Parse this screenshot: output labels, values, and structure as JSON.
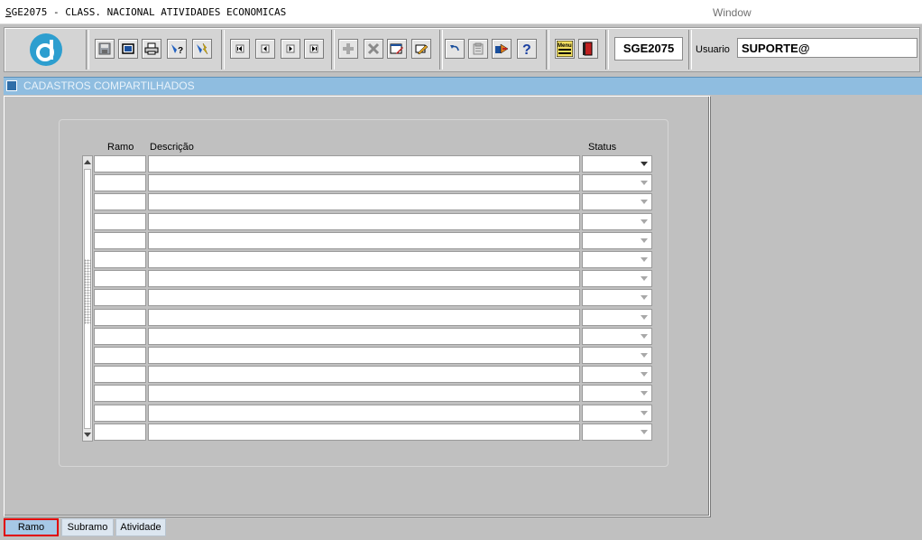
{
  "menubar": {
    "title_accel": "S",
    "title_rest": "GE2075 - CLASS. NACIONAL ATIVIDADES ECONOMICAS",
    "window_menu": "Window"
  },
  "toolbar": {
    "module_code": "SGE2075",
    "user_label": "Usuario",
    "user_value": "SUPORTE@",
    "menu_button_label": "Menu",
    "buttons": [
      {
        "name": "save-icon"
      },
      {
        "name": "window-icon"
      },
      {
        "name": "print-icon"
      },
      {
        "name": "query-icon"
      },
      {
        "name": "execute-query-icon"
      },
      {
        "name": "first-record-icon"
      },
      {
        "name": "previous-record-icon"
      },
      {
        "name": "next-record-icon"
      },
      {
        "name": "last-record-icon"
      },
      {
        "name": "insert-record-icon"
      },
      {
        "name": "delete-record-icon"
      },
      {
        "name": "edit-record-icon"
      },
      {
        "name": "clear-record-icon"
      },
      {
        "name": "undo-icon"
      },
      {
        "name": "clipboard-icon"
      },
      {
        "name": "pointer-icon"
      },
      {
        "name": "help-icon"
      },
      {
        "name": "menu-icon"
      },
      {
        "name": "exit-icon"
      }
    ]
  },
  "window": {
    "title": "CADASTROS COMPARTILHADOS"
  },
  "grid": {
    "columns": {
      "ramo": "Ramo",
      "descricao": "Descrição",
      "status": "Status"
    }
  },
  "tabs": [
    {
      "label": "Ramo",
      "active": true
    },
    {
      "label": "Subramo",
      "active": false
    },
    {
      "label": "Atividade",
      "active": false
    }
  ],
  "colors": {
    "accent_blue": "#2d9ecf",
    "window_title": "#8fbde0",
    "active_tab_border": "#e00000"
  }
}
